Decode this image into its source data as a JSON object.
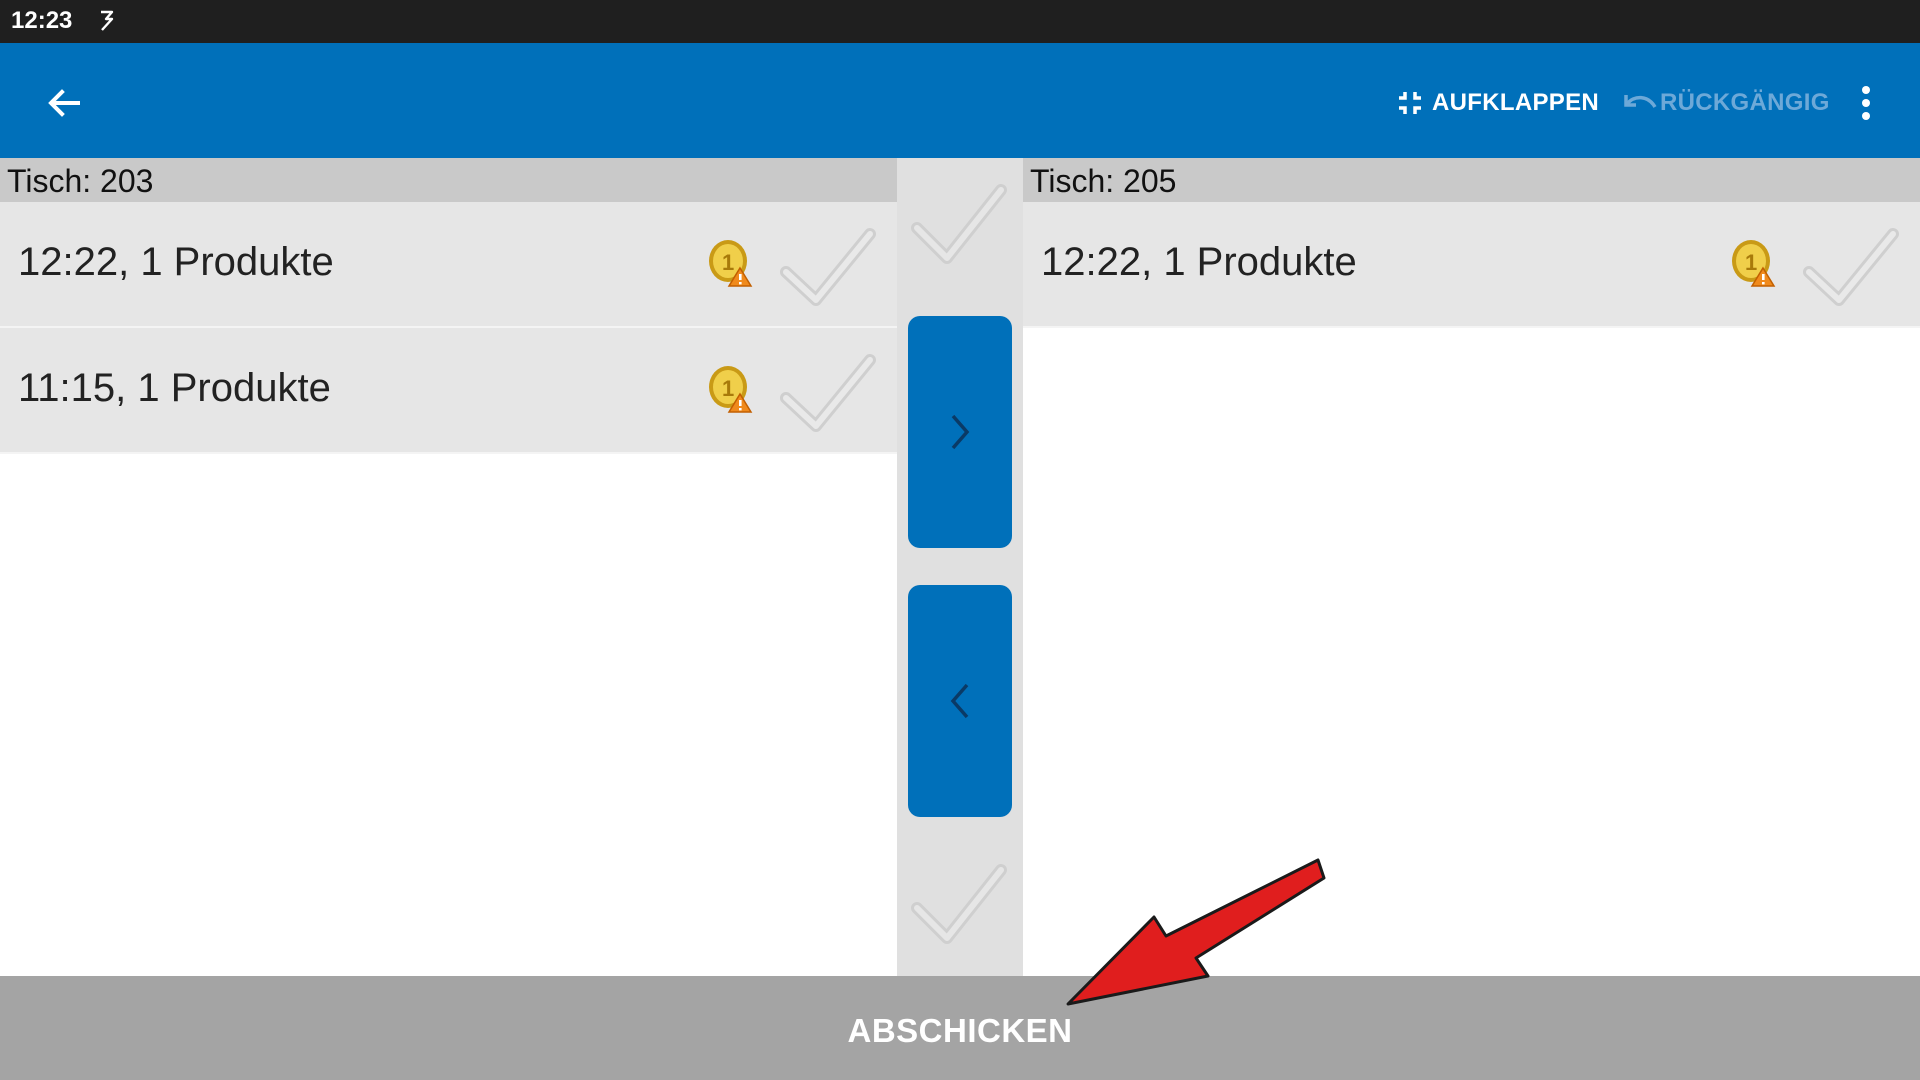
{
  "status_bar": {
    "time": "12:23",
    "notification_icon": "app-notification-icon"
  },
  "app_bar": {
    "back_icon": "arrow-left-icon",
    "actions": [
      {
        "label": "AUFKLAPPEN",
        "icon": "collapse-icon",
        "enabled": true
      },
      {
        "label": "RÜCKGÄNGIG",
        "icon": "undo-icon",
        "enabled": false
      }
    ],
    "overflow_icon": "more-vertical-icon"
  },
  "left_table": {
    "header": "Tisch: 203",
    "orders": [
      {
        "label": "12:22, 1 Produkte"
      },
      {
        "label": "11:15, 1 Produkte"
      }
    ]
  },
  "right_table": {
    "header": "Tisch: 205",
    "orders": [
      {
        "label": "12:22, 1 Produkte"
      }
    ]
  },
  "middle": {
    "move_right_icon": "chevron-right-icon",
    "move_left_icon": "chevron-left-icon"
  },
  "submit": {
    "label": "ABSCHICKEN"
  },
  "colors": {
    "primary": "#0070ba",
    "header_bg": "#c9c9c9",
    "row_bg": "#e6e6e6",
    "submit_bg": "#a4a4a4",
    "annotation": "#e01e1e"
  }
}
